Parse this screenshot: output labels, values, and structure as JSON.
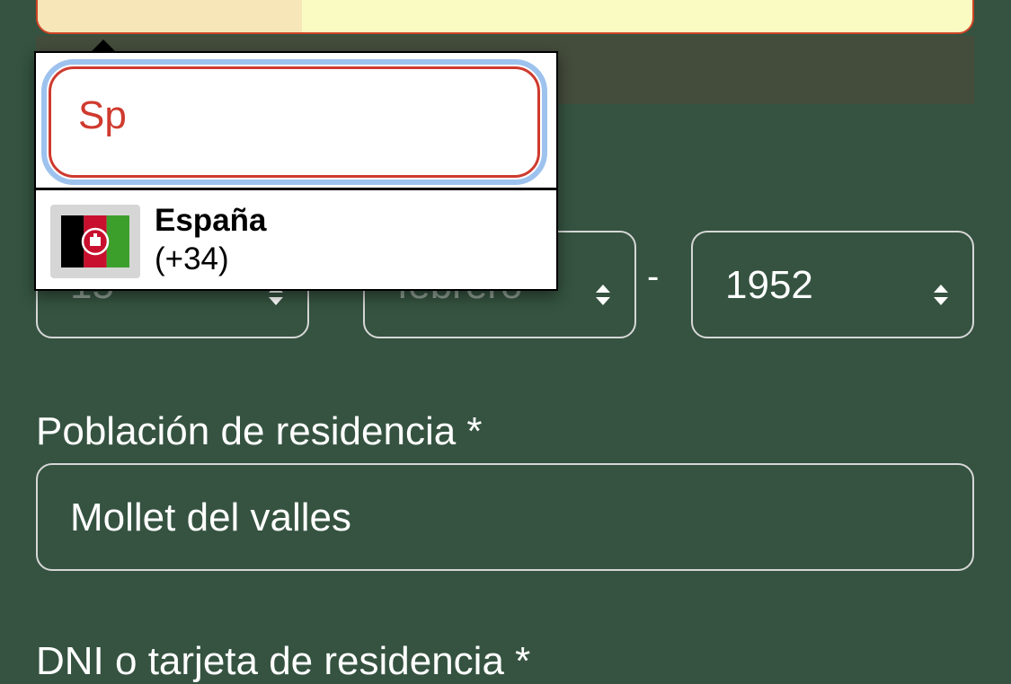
{
  "birth_date": {
    "day": "15",
    "month": "febrero",
    "separator": "-",
    "year": "1952"
  },
  "residence": {
    "label": "Población de residencia *",
    "value": "Mollet del valles"
  },
  "dni": {
    "label": "DNI o tarjeta de residencia *"
  },
  "country_picker": {
    "search_value": "Sp",
    "options": [
      {
        "name": "España",
        "code": "(+34)",
        "flag_icon": "afghanistan-flag-icon"
      }
    ]
  },
  "colors": {
    "background": "#355340",
    "error_border": "#cf4426",
    "focus_ring": "#9ec2ee",
    "phone_field_fill": "#f9fbc3"
  }
}
